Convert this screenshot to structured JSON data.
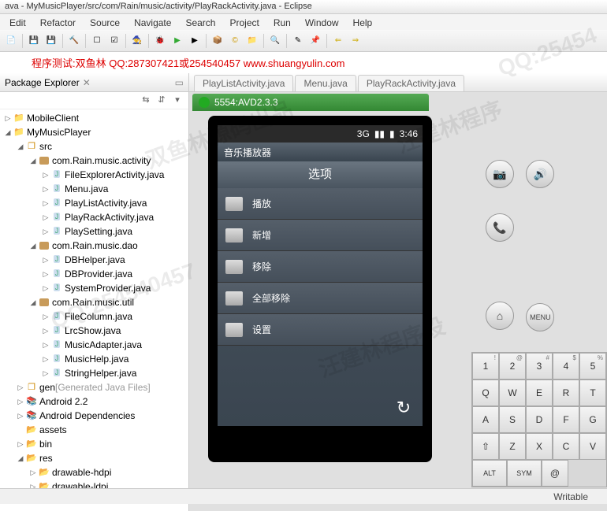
{
  "title": "ava - MyMusicPlayer/src/com/Rain/music/activity/PlayRackActivity.java - Eclipse",
  "menus": [
    "Edit",
    "Refactor",
    "Source",
    "Navigate",
    "Search",
    "Project",
    "Run",
    "Window",
    "Help"
  ],
  "red_text": "程序测试:双鱼林 QQ:287307421或254540457 www.shuangyulin.com",
  "pe_title": "Package Explorer",
  "tree": {
    "p1": "MobileClient",
    "p2": "MyMusicPlayer",
    "src": "src",
    "pkg_activity": "com.Rain.music.activity",
    "f_fileexp": "FileExplorerActivity.java",
    "f_menu": "Menu.java",
    "f_playlist": "PlayListActivity.java",
    "f_playrack": "PlayRackActivity.java",
    "f_playset": "PlaySetting.java",
    "pkg_dao": "com.Rain.music.dao",
    "f_dbhelper": "DBHelper.java",
    "f_dbprov": "DBProvider.java",
    "f_sysprov": "SystemProvider.java",
    "pkg_util": "com.Rain.music.util",
    "f_filecol": "FileColumn.java",
    "f_lrc": "LrcShow.java",
    "f_madapt": "MusicAdapter.java",
    "f_mhelp": "MusicHelp.java",
    "f_strhelp": "StringHelper.java",
    "gen": "gen",
    "gen_note": "[Generated Java Files]",
    "android": "Android 2.2",
    "deps": "Android Dependencies",
    "assets": "assets",
    "bin": "bin",
    "res": "res",
    "hdpi": "drawable-hdpi",
    "ldpi": "drawable-ldpi"
  },
  "tabs": {
    "t1": "PlayListActivity.java",
    "t2": "Menu.java",
    "t3": "PlayRackActivity.java"
  },
  "emulator_title": "5554:AVD2.3.3",
  "phone": {
    "time": "3:46",
    "sig": "3G",
    "app_title": "音乐播放器",
    "opt_header": "选项",
    "items": [
      "播放",
      "新增",
      "移除",
      "全部移除",
      "设置"
    ]
  },
  "side": {
    "menu": "MENU"
  },
  "keyboard": {
    "r1": [
      [
        "!",
        "1"
      ],
      [
        "@",
        "2"
      ],
      [
        "#",
        "3"
      ],
      [
        "$",
        "4"
      ],
      [
        "%",
        "5"
      ]
    ],
    "r2": [
      "Q",
      "W",
      "E",
      "R",
      "T"
    ],
    "r3": [
      "A",
      "S",
      "D",
      "F",
      "G"
    ],
    "r4": [
      "",
      "Z",
      "X",
      "C",
      "V"
    ],
    "r5": [
      "ALT",
      "SYM",
      "@"
    ]
  },
  "status": {
    "writable": "Writable"
  }
}
